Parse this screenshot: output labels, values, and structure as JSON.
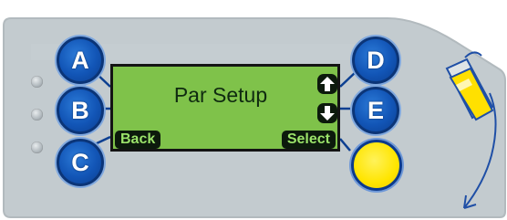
{
  "screen": {
    "title": "Par Setup"
  },
  "softkeys": {
    "left_label": "Back",
    "right_label": "Select"
  },
  "keys": {
    "a": "A",
    "b": "B",
    "c": "C",
    "d": "D",
    "e": "E"
  },
  "icons": {
    "up": "arrow-up-icon",
    "down": "arrow-down-icon",
    "card": "card-reader-icon",
    "insert": "insert-arrow-icon"
  },
  "colors": {
    "panel": "#c3cbcf",
    "button_blue": "#1255b6",
    "lcd_green": "#7fc24a",
    "accent_yellow": "#ffe500"
  }
}
